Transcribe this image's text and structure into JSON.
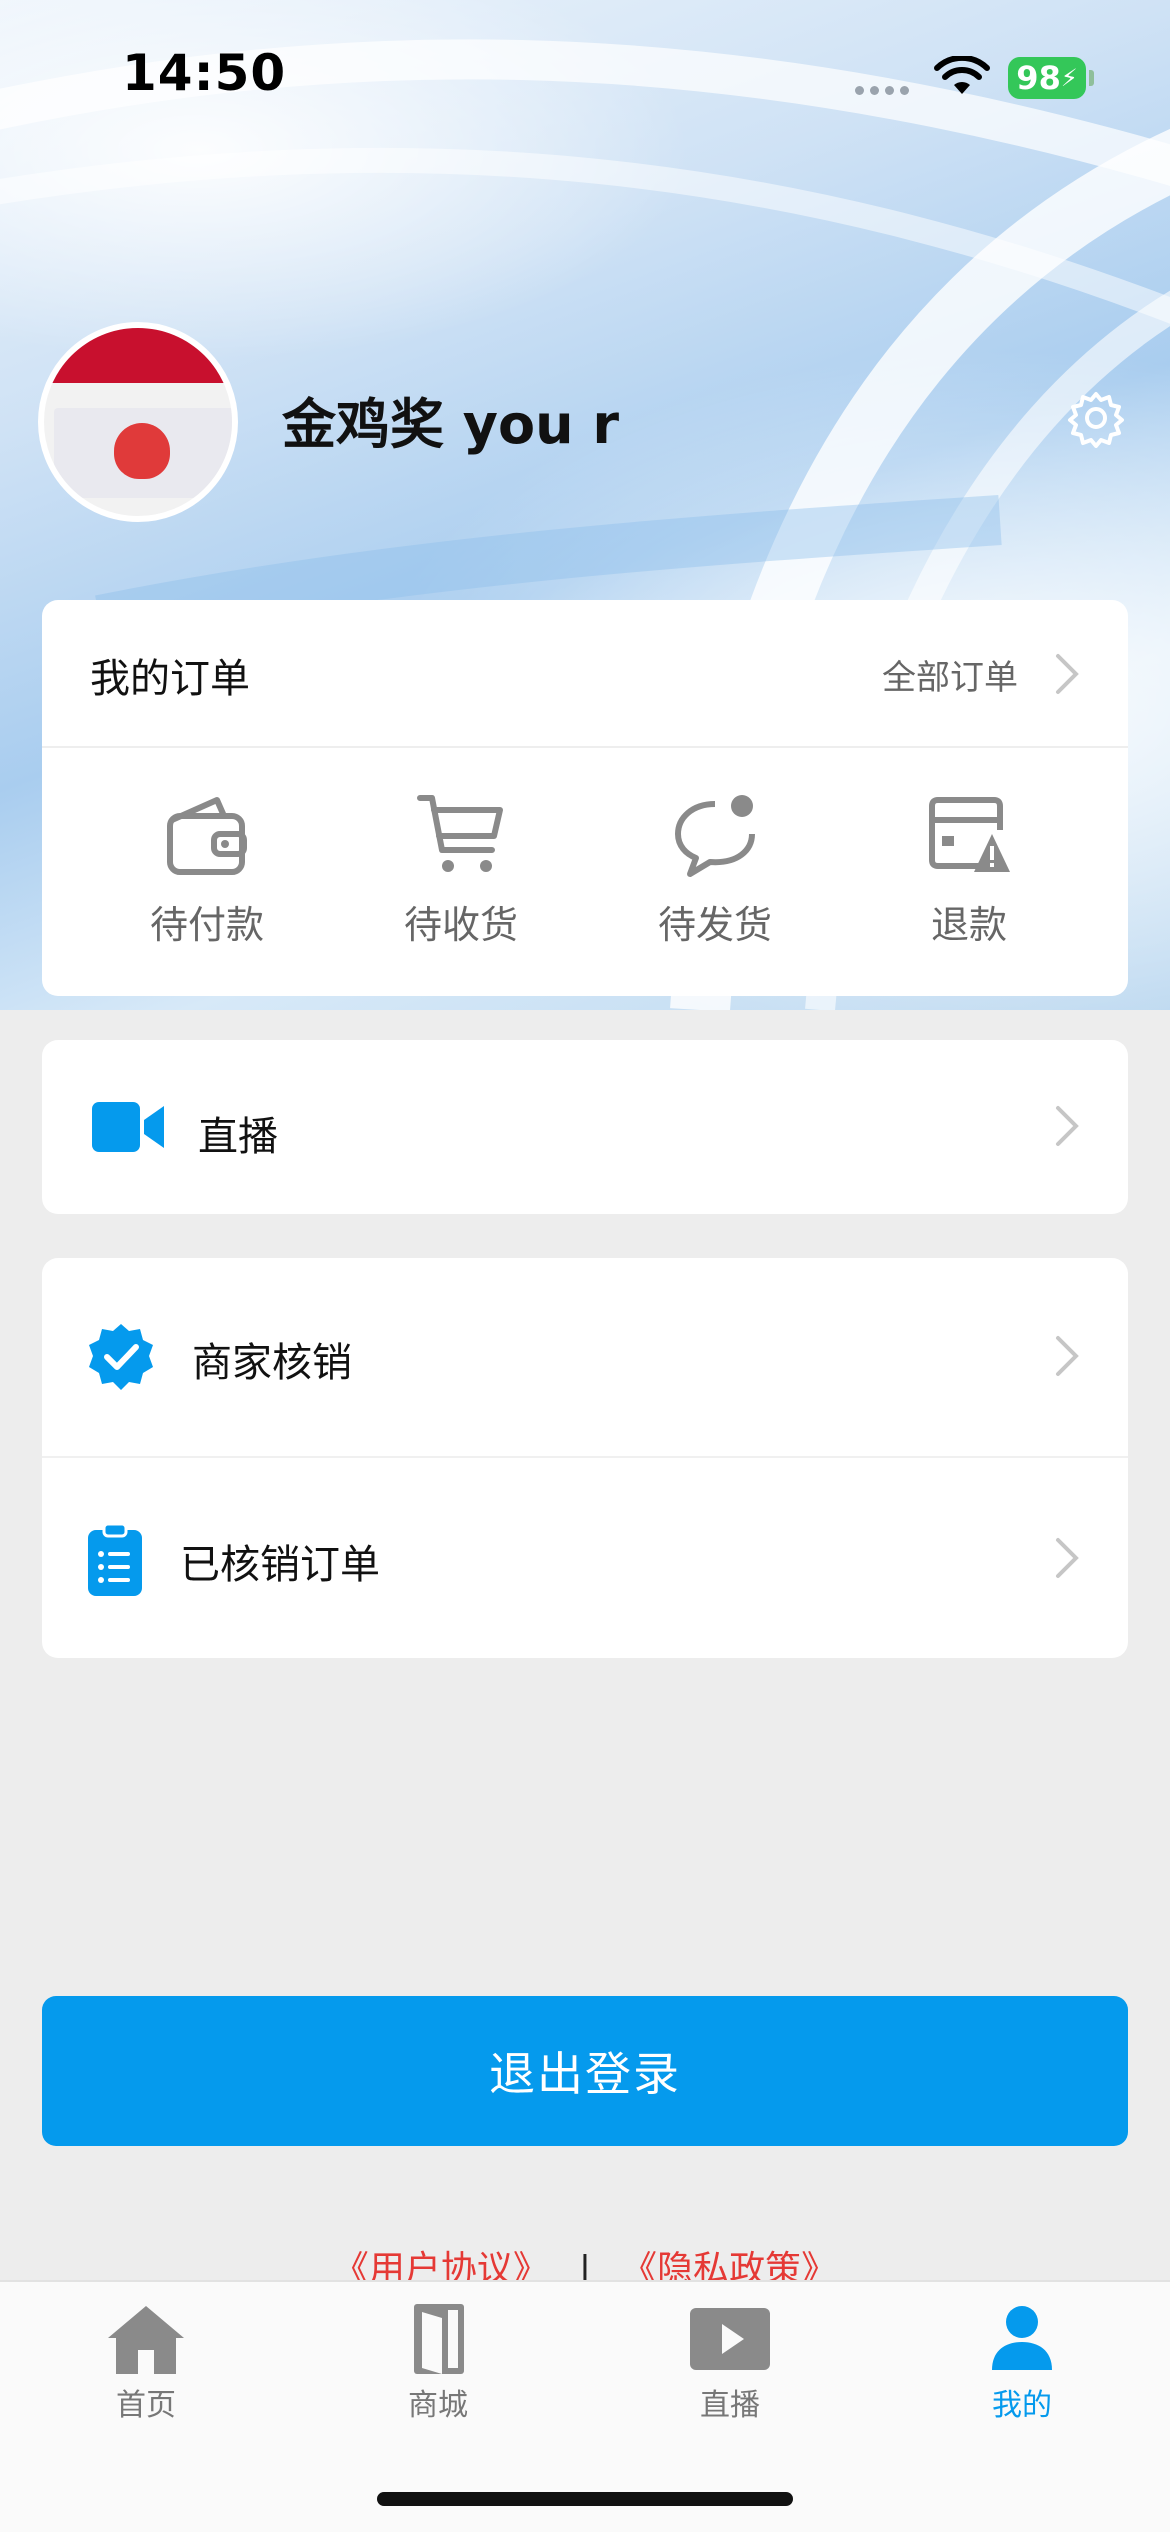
{
  "status_bar": {
    "time": "14:50",
    "battery": "98"
  },
  "profile": {
    "username": "金鸡奖 you r"
  },
  "orders": {
    "title": "我的订单",
    "all_label": "全部订单",
    "items": [
      {
        "label": "待付款",
        "icon": "wallet-icon"
      },
      {
        "label": "待收货",
        "icon": "cart-icon"
      },
      {
        "label": "待发货",
        "icon": "chat-bubble-icon"
      },
      {
        "label": "退款",
        "icon": "refund-card-icon"
      }
    ]
  },
  "menu": {
    "live_label": "直播",
    "merchant_verify_label": "商家核销",
    "verified_orders_label": "已核销订单"
  },
  "logout_label": "退出登录",
  "links": {
    "user_agreement": "《用户协议》",
    "separator": "|",
    "privacy_policy": "《隐私政策》"
  },
  "tabbar": {
    "items": [
      {
        "label": "首页",
        "icon": "home-icon"
      },
      {
        "label": "商城",
        "icon": "door-icon"
      },
      {
        "label": "直播",
        "icon": "play-icon"
      },
      {
        "label": "我的",
        "icon": "user-icon",
        "active": true
      }
    ]
  },
  "colors": {
    "accent": "#059aed",
    "link": "#e53935",
    "battery": "#34c759"
  }
}
